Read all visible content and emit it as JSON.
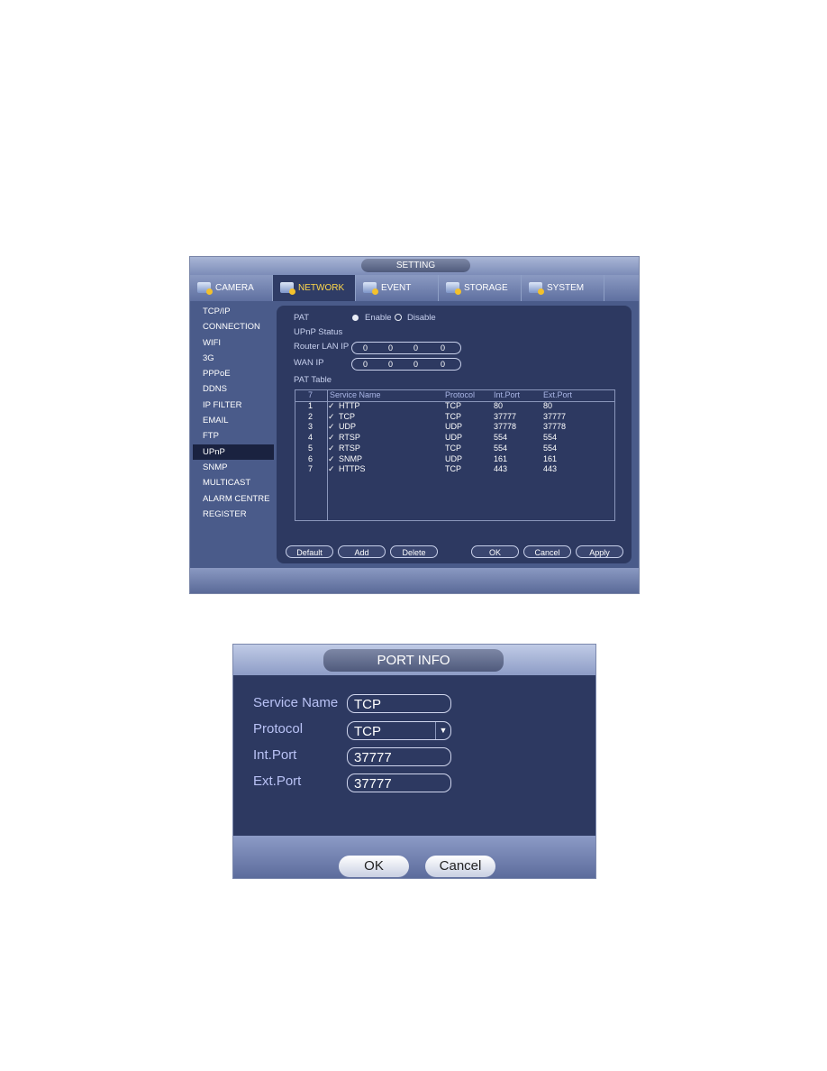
{
  "setting": {
    "title": "SETTING",
    "tabs": [
      {
        "label": "CAMERA",
        "icon": "camera-icon"
      },
      {
        "label": "NETWORK",
        "icon": "network-icon",
        "active": true
      },
      {
        "label": "EVENT",
        "icon": "event-icon"
      },
      {
        "label": "STORAGE",
        "icon": "storage-icon"
      },
      {
        "label": "SYSTEM",
        "icon": "system-icon"
      }
    ],
    "sidebar": [
      "TCP/IP",
      "CONNECTION",
      "WIFI",
      "3G",
      "PPPoE",
      "DDNS",
      "IP FILTER",
      "EMAIL",
      "FTP",
      "UPnP",
      "SNMP",
      "MULTICAST",
      "ALARM CENTRE",
      "REGISTER"
    ],
    "active_sidebar": "UPnP",
    "pat_label": "PAT",
    "enable_label": "Enable",
    "disable_label": "Disable",
    "pat_value": "Enable",
    "upnp_status_label": "UPnP Status",
    "router_lan_ip_label": "Router LAN IP",
    "router_lan_ip": [
      "0",
      "0",
      "0",
      "0"
    ],
    "wan_ip_label": "WAN IP",
    "wan_ip": [
      "0",
      "0",
      "0",
      "0"
    ],
    "pat_table_label": "PAT Table",
    "table": {
      "headers": [
        "7",
        "Service Name",
        "Protocol",
        "Int.Port",
        "Ext.Port"
      ],
      "rows": [
        [
          "1",
          "HTTP",
          "TCP",
          "80",
          "80"
        ],
        [
          "2",
          "TCP",
          "TCP",
          "37777",
          "37777"
        ],
        [
          "3",
          "UDP",
          "UDP",
          "37778",
          "37778"
        ],
        [
          "4",
          "RTSP",
          "UDP",
          "554",
          "554"
        ],
        [
          "5",
          "RTSP",
          "TCP",
          "554",
          "554"
        ],
        [
          "6",
          "SNMP",
          "UDP",
          "161",
          "161"
        ],
        [
          "7",
          "HTTPS",
          "TCP",
          "443",
          "443"
        ]
      ]
    },
    "buttons": {
      "default": "Default",
      "add": "Add",
      "delete": "Delete",
      "ok": "OK",
      "cancel": "Cancel",
      "apply": "Apply"
    }
  },
  "port_info": {
    "title": "PORT INFO",
    "service_name_label": "Service Name",
    "service_name": "TCP",
    "protocol_label": "Protocol",
    "protocol": "TCP",
    "int_port_label": "Int.Port",
    "int_port": "37777",
    "ext_port_label": "Ext.Port",
    "ext_port": "37777",
    "ok": "OK",
    "cancel": "Cancel"
  }
}
